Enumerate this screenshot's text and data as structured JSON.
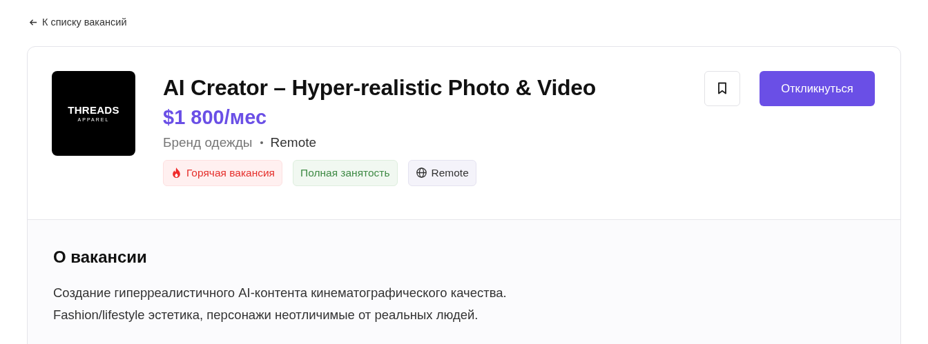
{
  "back_link": {
    "label": "К списку вакансий"
  },
  "company_logo": {
    "name": "THREADS",
    "subtitle": "APPAREL"
  },
  "job": {
    "title": "AI Creator – Hyper-realistic Photo & Video",
    "salary": "$1 800/мес",
    "company": "Бренд одежды",
    "location": "Remote"
  },
  "tags": [
    {
      "kind": "hot",
      "label": "Горячая вакансия"
    },
    {
      "kind": "employment",
      "label": "Полная занятость"
    },
    {
      "kind": "remote",
      "label": "Remote"
    }
  ],
  "actions": {
    "bookmarked": false,
    "apply_label": "Откликнуться"
  },
  "about": {
    "heading": "О вакансии",
    "lines": [
      "Создание гиперреалистичного AI-контента кинематографического качества.",
      "Fashion/lifestyle эстетика, персонажи неотличимые от реальных людей."
    ]
  }
}
